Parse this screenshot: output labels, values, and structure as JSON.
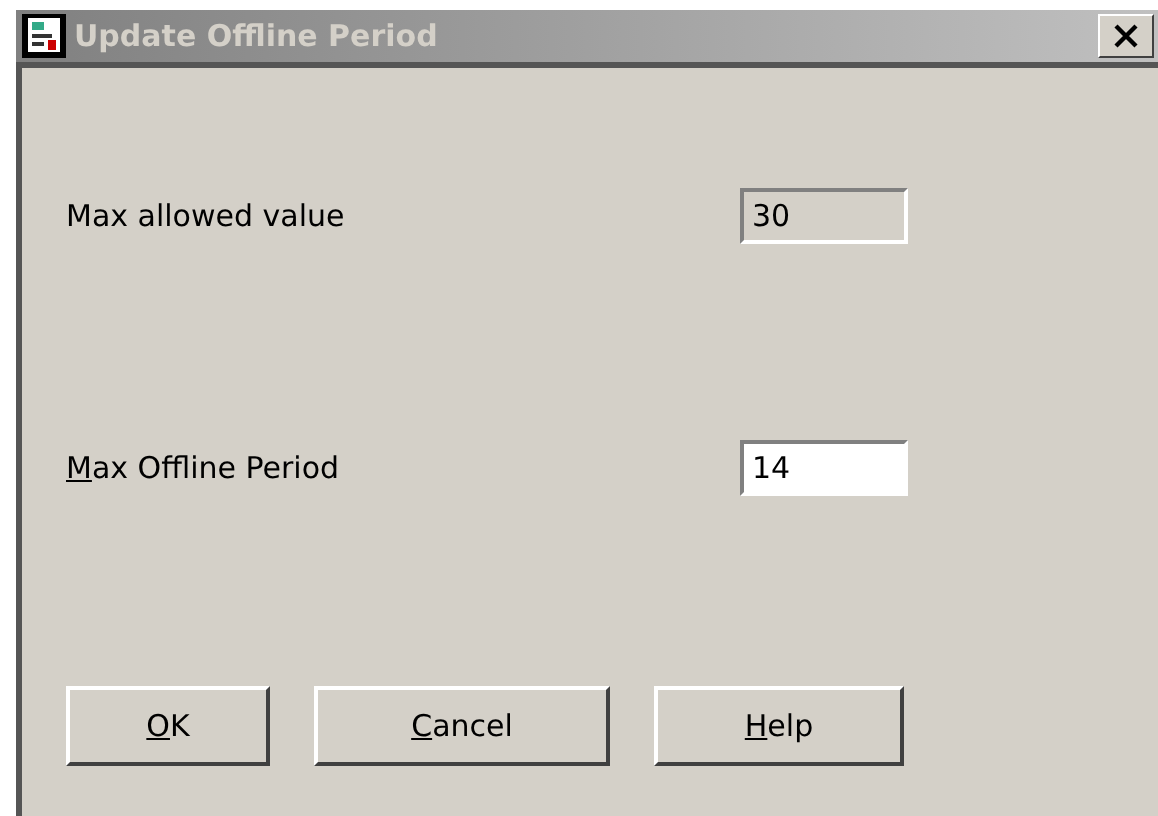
{
  "window": {
    "title": "Update Offline Period",
    "active": false
  },
  "fields": [
    {
      "label": "Max allowed value",
      "value": "30",
      "disabled": true,
      "underline_first": false
    },
    {
      "label": "Max Offline Period",
      "value": "14",
      "disabled": false,
      "underline_first": true
    }
  ],
  "buttons": [
    {
      "label": "OK",
      "underline_first": true
    },
    {
      "label": "Cancel",
      "underline_first": true
    },
    {
      "label": "Help",
      "underline_first": true
    }
  ]
}
